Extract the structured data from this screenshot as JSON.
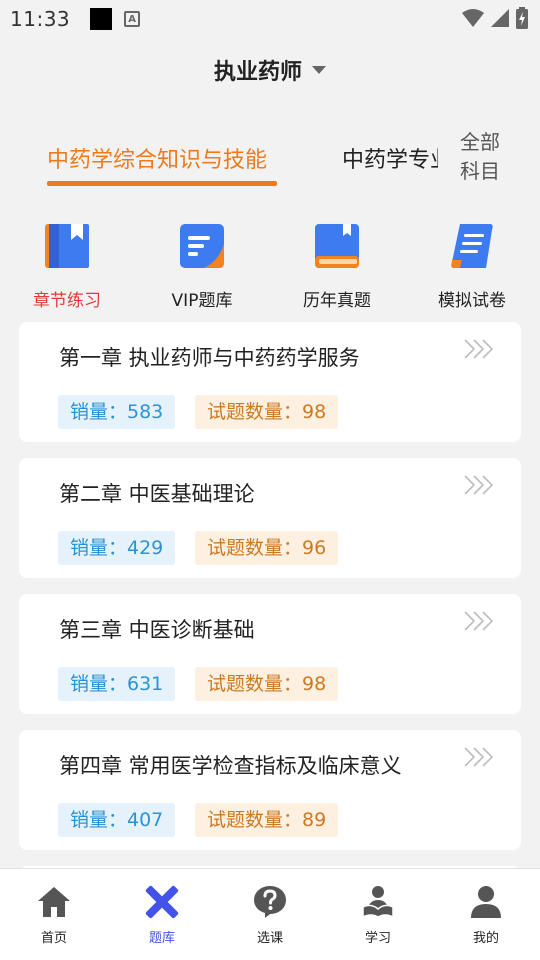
{
  "status_bar": {
    "time": "11:33",
    "icons": [
      "notification-square-icon",
      "a-icon",
      "wifi-icon",
      "signal-icon",
      "battery-icon"
    ]
  },
  "header": {
    "title": "执业药师",
    "caret_icon": "caret-down-icon"
  },
  "tabs": {
    "active": "中药学综合知识与技能",
    "second": "中药学专业知识",
    "all_line1": "全部",
    "all_line2": "科目"
  },
  "categories": [
    {
      "label": "章节练习",
      "icon": "chapter-book-icon",
      "active": true
    },
    {
      "label": "VIP题库",
      "icon": "vip-document-icon",
      "active": false
    },
    {
      "label": "历年真题",
      "icon": "past-exam-book-icon",
      "active": false
    },
    {
      "label": "模拟试卷",
      "icon": "scroll-paper-icon",
      "active": false
    }
  ],
  "chapters": [
    {
      "title": "第一章 执业药师与中药药学服务",
      "sales": "销量：583",
      "count": "试题数量：98"
    },
    {
      "title": "第二章 中医基础理论",
      "sales": "销量：429",
      "count": "试题数量：96"
    },
    {
      "title": "第三章 中医诊断基础",
      "sales": "销量：631",
      "count": "试题数量：98"
    },
    {
      "title": "第四章 常用医学检查指标及临床意义",
      "sales": "销量：407",
      "count": "试题数量：89"
    }
  ],
  "bottom_nav": [
    {
      "label": "首页",
      "icon": "home-icon",
      "active": false
    },
    {
      "label": "题库",
      "icon": "pencil-ruler-icon",
      "active": true
    },
    {
      "label": "选课",
      "icon": "question-icon",
      "active": false
    },
    {
      "label": "学习",
      "icon": "study-reader-icon",
      "active": false
    },
    {
      "label": "我的",
      "icon": "user-icon",
      "active": false
    }
  ],
  "colors": {
    "accent_orange": "#ef7a1a",
    "active_red": "#e53935",
    "nav_active_blue": "#4353e8",
    "sales_blue": "#2a93d5",
    "count_orange": "#cc7a22"
  }
}
